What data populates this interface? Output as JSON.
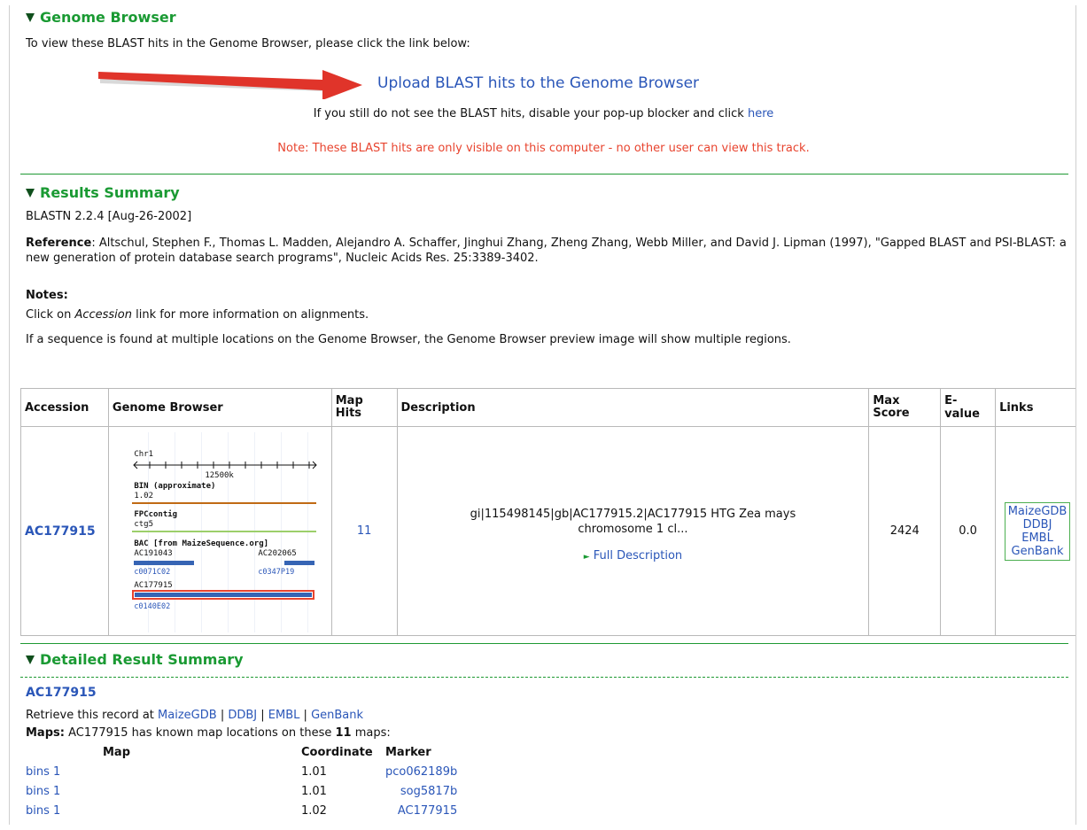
{
  "genome_browser": {
    "title": "Genome Browser",
    "intro": "To view these BLAST hits in the Genome Browser, please click the link below:",
    "upload_link": "Upload BLAST hits to the Genome Browser",
    "popup_text": "If you still do not see the BLAST hits, disable your pop-up blocker and click",
    "here_link": "here",
    "note": "Note: These BLAST hits are only visible on this computer - no other user can view this track."
  },
  "results_summary": {
    "title": "Results Summary",
    "version": "BLASTN 2.2.4 [Aug-26-2002]",
    "reference_label": "Reference",
    "reference_text": ": Altschul, Stephen F., Thomas L. Madden, Alejandro A. Schaffer, Jinghui Zhang, Zheng Zhang, Webb Miller, and David J. Lipman (1997), \"Gapped BLAST and PSI-BLAST: a new generation of protein database search programs\", Nucleic Acids Res. 25:3389-3402.",
    "notes_label": "Notes:",
    "note1_pre": "Click on ",
    "note1_italic": "Accession",
    "note1_post": " link for more information on alignments.",
    "note2": "If a sequence is found at multiple locations on the Genome Browser, the Genome Browser preview image will show multiple regions."
  },
  "table": {
    "headers": {
      "accession": "Accession",
      "genome_browser": "Genome Browser",
      "map_hits": "Map Hits",
      "description": "Description",
      "max_score": "Max Score",
      "evalue": "E-value",
      "links": "Links"
    },
    "row": {
      "accession": "AC177915",
      "map_hits": "11",
      "description": "gi|115498145|gb|AC177915.2|AC177915 HTG Zea mays chromosome 1 cl...",
      "full_description": "Full Description",
      "max_score": "2424",
      "evalue": "0.0",
      "links": [
        "MaizeGDB",
        "DDBJ",
        "EMBL",
        "GenBank"
      ]
    },
    "preview": {
      "chr_label": "Chr1",
      "scale_label": "12500k",
      "bin_label": "BIN (approximate)",
      "bin_value": "1.02",
      "fpc_label": "FPCcontig",
      "fpc_value": "ctg5",
      "bac_label": "BAC [from MaizeSequence.org]",
      "bac1": "AC191043",
      "bac2": "AC202065",
      "link1": "c0071C02",
      "link2": "c0347P19",
      "bac3": "AC177915",
      "link3": "c0140E02",
      "colors": {
        "bin_line": "#c06a14",
        "fpc_line": "#9ccf6a",
        "bac_bar": "#3664b4",
        "highlight": "#e8442f"
      }
    }
  },
  "detailed": {
    "title": "Detailed Result Summary",
    "accession": "AC177915",
    "retrieve_pre": "Retrieve this record at",
    "retrieve_links": [
      "MaizeGDB",
      "DDBJ",
      "EMBL",
      "GenBank"
    ],
    "separator": "|",
    "maps_label": "Maps:",
    "maps_pre": "AC177915 has known map locations on these",
    "maps_count": "11",
    "maps_post": "maps:",
    "maps_headers": [
      "Map",
      "Coordinate",
      "Marker"
    ],
    "maps_rows": [
      {
        "map": "bins 1",
        "coordinate": "1.01",
        "marker": "pco062189b"
      },
      {
        "map": "bins 1",
        "coordinate": "1.01",
        "marker": "sog5817b"
      },
      {
        "map": "bins 1",
        "coordinate": "1.02",
        "marker": "AC177915"
      }
    ]
  },
  "colors": {
    "section_title": "#1a9a33",
    "link": "#2a56b8",
    "note_red": "#e8442f",
    "arrow_red": "#e0342a"
  }
}
